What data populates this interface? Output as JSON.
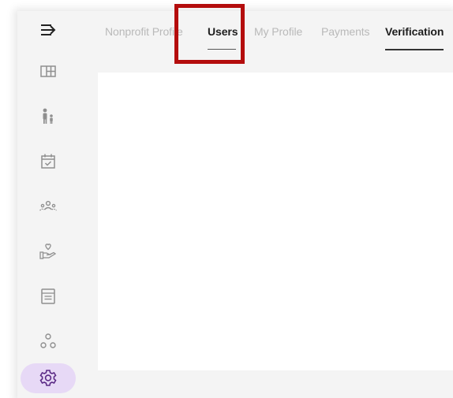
{
  "tabs": [
    {
      "label": "Nonprofit Profile"
    },
    {
      "label": "Users"
    },
    {
      "label": "My Profile"
    },
    {
      "label": "Payments"
    },
    {
      "label": "Verification"
    }
  ],
  "sidebar": {
    "items": [
      {
        "icon": "collapse-arrow-icon"
      },
      {
        "icon": "dashboard-icon"
      },
      {
        "icon": "people-icon"
      },
      {
        "icon": "calendar-check-icon"
      },
      {
        "icon": "group-icon"
      },
      {
        "icon": "hand-heart-icon"
      },
      {
        "icon": "document-list-icon"
      },
      {
        "icon": "network-icon"
      },
      {
        "icon": "settings-gear-icon",
        "active": true
      }
    ]
  },
  "colors": {
    "highlight": "#b40d0d",
    "active_pill": "#e7d9f6",
    "sidebar_bg": "#f4f4f4",
    "icon_color": "#8f8f8f",
    "active_icon": "#5b2a86"
  }
}
